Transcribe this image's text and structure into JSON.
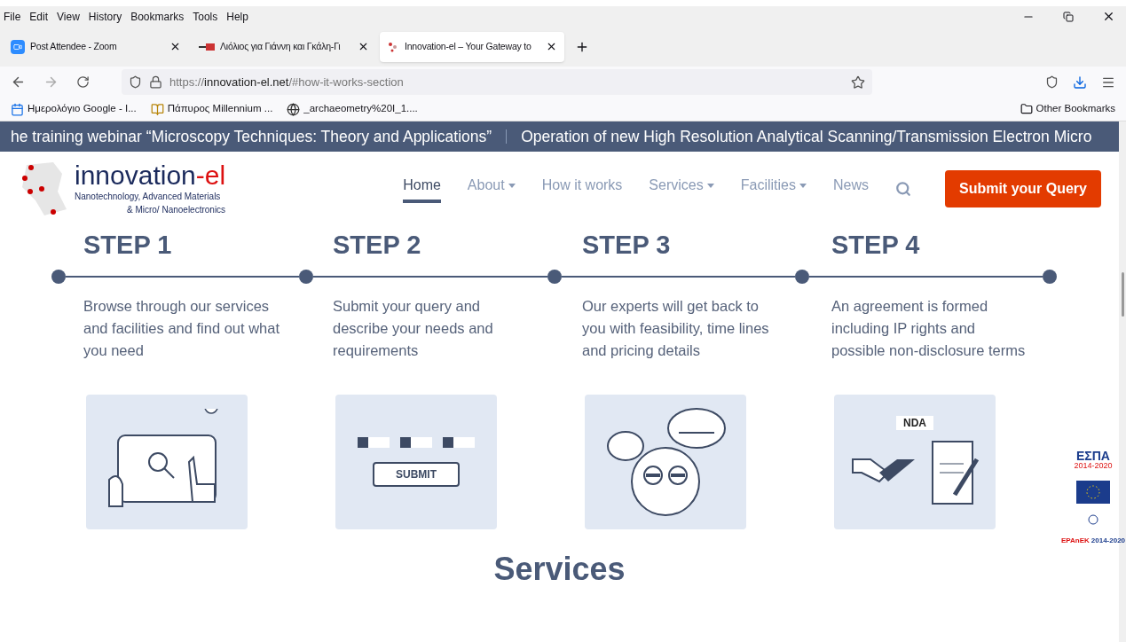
{
  "menu": [
    "File",
    "Edit",
    "View",
    "History",
    "Bookmarks",
    "Tools",
    "Help"
  ],
  "tabs": [
    {
      "title": "Post Attendee - Zoom",
      "selected": false,
      "kind": "camera"
    },
    {
      "title": "Λιόλιος για Γιάννη και Γκάλη-Γι",
      "selected": false,
      "kind": "flag"
    },
    {
      "title": "Innovation-el – Your Gateway to",
      "selected": true,
      "kind": "site"
    }
  ],
  "url": {
    "prefix": "https://",
    "domain": "innovation-el.net",
    "path": "/#how-it-works-section"
  },
  "bookmarks": [
    {
      "label": "Ημερολόγιο Google - I...",
      "kind": "calendar"
    },
    {
      "label": "Πάπυρος Millennium ...",
      "kind": "book"
    },
    {
      "label": "_archaeometry%20I_1....",
      "kind": "globe"
    }
  ],
  "other_bookmarks": "Other Bookmarks",
  "ticker": [
    "he training webinar “Microscopy Techniques: Theory and Applications”",
    "Operation of new High Resolution Analytical Scanning/Transmission Electron Micro"
  ],
  "logo": {
    "name": "innovation",
    "suffix": "-el",
    "tagline_1": "Nanotechnology, Advanced Materials",
    "tagline_2": "& Micro/ Nanoelectronics"
  },
  "nav": [
    {
      "label": "Home",
      "selected": true,
      "dropdown": false
    },
    {
      "label": "About",
      "selected": false,
      "dropdown": true
    },
    {
      "label": "How it works",
      "selected": false,
      "dropdown": false
    },
    {
      "label": "Services",
      "selected": false,
      "dropdown": true
    },
    {
      "label": "Facilities",
      "selected": false,
      "dropdown": true
    },
    {
      "label": "News",
      "selected": false,
      "dropdown": false
    }
  ],
  "cta": "Submit your Query",
  "steps": [
    {
      "title": "STEP 1",
      "text": "Browse through our services and facilities and find out what you need",
      "kind": "tablet"
    },
    {
      "title": "STEP 2",
      "text": "Submit your query and describe your needs and requirements",
      "kind": "form",
      "label": "SUBMIT"
    },
    {
      "title": "STEP 3",
      "text": "Our experts will get back to you with feasibility, time lines and pricing details",
      "kind": "experts"
    },
    {
      "title": "STEP 4",
      "text": "An agreement is formed including IP rights and possible non-disclosure terms",
      "kind": "agreement",
      "label": "NDA"
    }
  ],
  "sponsors": {
    "espa": "ΕΣΠΑ",
    "espa_years": "2014-2020",
    "epanek": "EPAnEK",
    "epanek_years": "2014-2020"
  },
  "section_title": "Services"
}
